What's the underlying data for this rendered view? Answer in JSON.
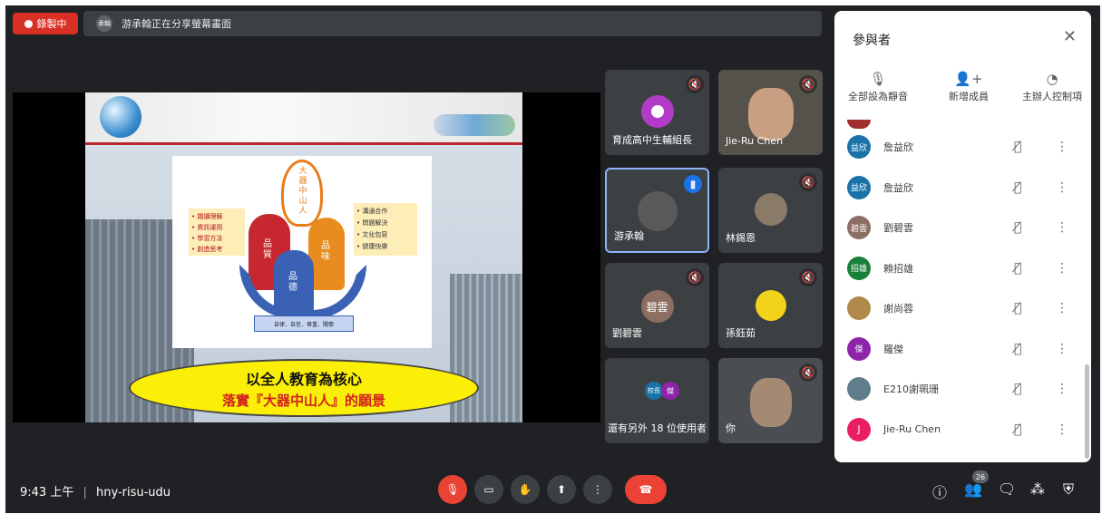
{
  "recording": {
    "label": "錄製中"
  },
  "share_bar": {
    "avatar": "承翰",
    "text": "游承翰正在分享螢幕畫面"
  },
  "slide": {
    "left_box": "• 閱讀理解\n• 資訊運用\n• 學習方法\n• 創造思考",
    "right_box": "• 溝通合作\n• 問題解決\n• 文化包容\n• 健康快樂",
    "center_vertical": "大器中山人",
    "fig_left": "品質",
    "fig_right": "品味",
    "fig_bottom": "品德",
    "tag": "自律．自信．尊重．關懷",
    "line1": "以全人教育為核心",
    "line2": "落實『大器中山人』的願景"
  },
  "tiles": [
    {
      "name": "育成高中生輔組長"
    },
    {
      "name": "Jie-Ru Chen"
    },
    {
      "name": "游承翰"
    },
    {
      "name": "林錫恩"
    },
    {
      "name": "劉碧雲",
      "avatar": "碧雲"
    },
    {
      "name": "孫鈺茹"
    },
    {
      "name": "還有另外 18 位使用者",
      "avatar1": "校長",
      "avatar2": "傑"
    },
    {
      "name": "你"
    }
  ],
  "panel": {
    "title": "參與者",
    "actions": [
      {
        "label": "全部設為靜音",
        "icon": "mic-off-icon"
      },
      {
        "label": "新增成員",
        "icon": "person-add-icon"
      },
      {
        "label": "主辦人控制項",
        "icon": "toggle-icon"
      }
    ],
    "participants": [
      {
        "avatar": "益欣",
        "name": "詹益欣",
        "color": "#1a73a8"
      },
      {
        "avatar": "益欣",
        "name": "詹益欣",
        "color": "#1a73a8"
      },
      {
        "avatar": "碧雲",
        "name": "劉碧雲",
        "color": "#8d6e63"
      },
      {
        "avatar": "招雄",
        "name": "賴招雄",
        "color": "#188038"
      },
      {
        "avatar": "",
        "name": "謝尚蓉",
        "color": "#b08a4a"
      },
      {
        "avatar": "傑",
        "name": "羅傑",
        "color": "#8e24aa"
      },
      {
        "avatar": "",
        "name": "E210謝珮珊",
        "color": "#607d8b"
      },
      {
        "avatar": "J",
        "name": "Jie-Ru Chen",
        "color": "#e91e63"
      }
    ]
  },
  "bottom": {
    "time": "9:43 上午",
    "meeting_code": "hny-risu-udu",
    "participant_count": "26"
  }
}
